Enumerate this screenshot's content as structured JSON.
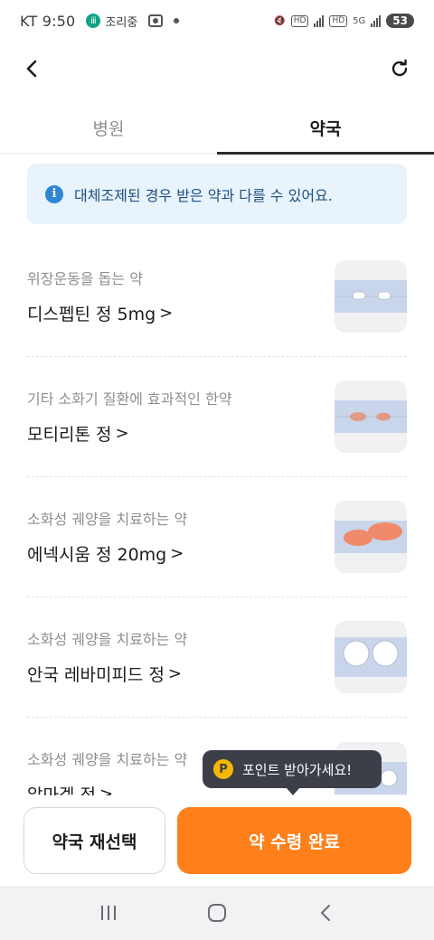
{
  "status_bar": {
    "carrier_time": "KT 9:50",
    "app_status": "조리중",
    "battery": "53",
    "network_5g": "5G",
    "hd_label": "HD"
  },
  "tabs": [
    {
      "label": "병원",
      "active": false
    },
    {
      "label": "약국",
      "active": true
    }
  ],
  "notice": {
    "text": "대체조제된 경우 받은 약과 다를 수 있어요."
  },
  "medications": [
    {
      "description": "위장운동을 돕는 약",
      "name": "디스펩틴 정 5mg",
      "chevron": ">",
      "pill_colors": [
        "#ffffff",
        "#ffffff"
      ]
    },
    {
      "description": "기타 소화기 질환에 효과적인 한약",
      "name": "모티리톤 정",
      "chevron": ">",
      "pill_colors": [
        "#e29a86",
        "#e29a86"
      ]
    },
    {
      "description": "소화성 궤양을 치료하는 약",
      "name": "에넥시움 정 20mg",
      "chevron": ">",
      "pill_colors": [
        "#ef8a6a",
        "#ef8a6a"
      ]
    },
    {
      "description": "소화성 궤양을 치료하는 약",
      "name": "안국 레바미피드 정",
      "chevron": ">",
      "pill_colors": [
        "#ffffff",
        "#ffffff"
      ]
    },
    {
      "description": "소화성 궤양을 치료하는 약",
      "name": "알마겔 정",
      "chevron": ">",
      "pill_colors": [
        "#ffffff",
        "#ffffff"
      ]
    }
  ],
  "tooltip": {
    "icon_letter": "P",
    "text": "포인트 받아가세요!"
  },
  "actions": {
    "reselect_label": "약국 재선택",
    "complete_label": "약 수령 완료"
  },
  "colors": {
    "accent_orange": "#ff7f1a",
    "notice_bg": "#e8f3fb",
    "info_blue": "#2f86d4",
    "point_yellow": "#f5b700"
  }
}
